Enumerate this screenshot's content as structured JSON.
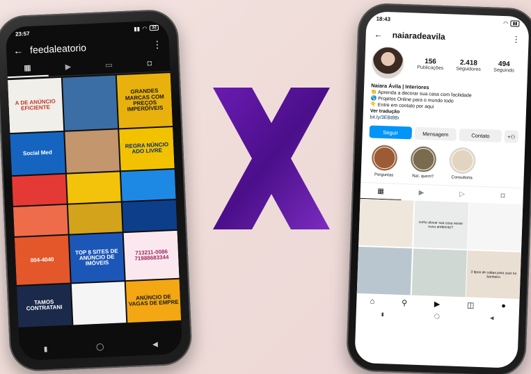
{
  "left_phone": {
    "status": {
      "time": "23:57",
      "battery": "32"
    },
    "header": {
      "username": "feedaleatorio"
    },
    "posts": [
      {
        "text": "A DE ANÚNCIO EFICIENTE",
        "bg": "#f0efe9",
        "fg": "#c0392b"
      },
      {
        "text": "",
        "bg": "#3a6ea5",
        "fg": "#ffffff"
      },
      {
        "text": "GRANDES MARCAS COM PREÇOS IMPERDÍVEIS",
        "bg": "#e8b10d",
        "fg": "#1a1a1a"
      },
      {
        "text": "Social Med",
        "bg": "#1565c0",
        "fg": "#ffffff"
      },
      {
        "text": "",
        "bg": "#c3966d",
        "fg": "#ffffff"
      },
      {
        "text": "REGRA NÚNCIO ADO LIVRE",
        "bg": "#f2c200",
        "fg": "#0b2f6b"
      },
      {
        "text": "",
        "bg": "#e53935",
        "fg": "#ffffff"
      },
      {
        "text": "",
        "bg": "#f3c20a",
        "fg": "#2a2a2a"
      },
      {
        "text": "",
        "bg": "#1e88e5",
        "fg": "#ffffff"
      },
      {
        "text": "",
        "bg": "#ef6c4b",
        "fg": "#ffffff"
      },
      {
        "text": "",
        "bg": "#d4a31c",
        "fg": "#3a2100"
      },
      {
        "text": "",
        "bg": "#0d3e8a",
        "fg": "#ffffff"
      },
      {
        "text": "004-4040",
        "bg": "#e3572a",
        "fg": "#ffffff"
      },
      {
        "text": "TOP 8 SITES DE ANÚNCIO DE IMÓVEIS",
        "bg": "#1c57b8",
        "fg": "#ffffff"
      },
      {
        "text": "713211-0086 71988683344",
        "bg": "#fbe8ef",
        "fg": "#a1285d"
      },
      {
        "text": "TAMOS CONTRATANI",
        "bg": "#1b2a4a",
        "fg": "#ffffff"
      },
      {
        "text": "",
        "bg": "#f5f5f5",
        "fg": "#1a1a1a"
      },
      {
        "text": "ANÚNCIO DE VAGAS DE EMPRE",
        "bg": "#f3a712",
        "fg": "#1c1c1c"
      }
    ]
  },
  "right_phone": {
    "status": {
      "time": "18:43"
    },
    "header": {
      "username": "naiaradeavila"
    },
    "stats": [
      {
        "value": "156",
        "label": "Publicações"
      },
      {
        "value": "2.418",
        "label": "Seguidores"
      },
      {
        "value": "494",
        "label": "Seguindo"
      }
    ],
    "bio": {
      "name": "Naiara Ávila | Interiores",
      "lines": [
        "👏 Aprenda a decorar sua casa com facilidade",
        "🌎 Projetos Online para o mundo todo",
        "👇 Entre em contato por aqui"
      ],
      "translate": "Ver tradução",
      "link": "bit.ly/3EBt8Bi"
    },
    "buttons": {
      "follow": "Seguir",
      "message": "Mensagem",
      "contact": "Contato"
    },
    "highlights": [
      {
        "label": "Perguntas",
        "color": "#9b5b34"
      },
      {
        "label": "Naí, quem?",
        "color": "#7a6b4f"
      },
      {
        "label": "Consultoria",
        "color": "#e1d5c2"
      }
    ],
    "posts": [
      {
        "text": "",
        "bg": "#efe7dc"
      },
      {
        "text": "como alocar sua casa nesse novo ambiente?",
        "bg": "#e9ecea"
      },
      {
        "text": "",
        "bg": "#f6f6f6"
      },
      {
        "text": "",
        "bg": "#b9c6cf"
      },
      {
        "text": "",
        "bg": "#cfd8d2"
      },
      {
        "text": "3 tipos de cabas para usar no banheiro",
        "bg": "#eadfd3"
      }
    ]
  },
  "center": {
    "symbol": "X"
  }
}
